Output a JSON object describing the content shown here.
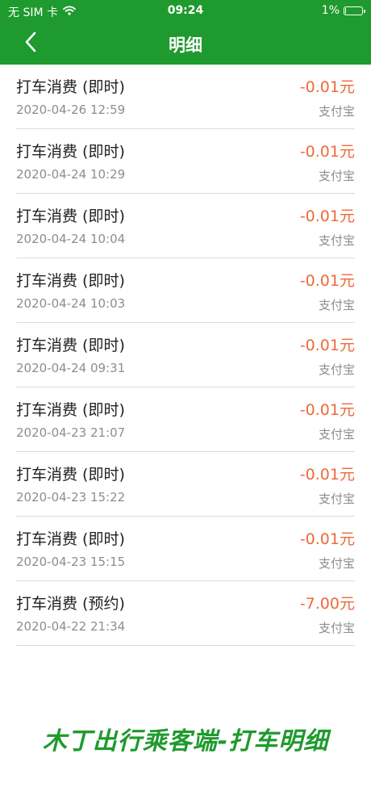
{
  "status_bar": {
    "carrier": "无 SIM 卡",
    "time": "09:24",
    "battery": "1%",
    "battery_level": 0.01
  },
  "header": {
    "title": "明细",
    "back_icon": "chevron-left-icon"
  },
  "colors": {
    "brand": "#1f9a2e",
    "amount": "#ee6a3b",
    "secondary_text": "#8d8d8d",
    "divider": "#dcdcdc"
  },
  "transactions": [
    {
      "desc": "打车消费 (即时)",
      "date": "2020-04-26 12:59",
      "amount": "-0.01元",
      "method": "支付宝"
    },
    {
      "desc": "打车消费 (即时)",
      "date": "2020-04-24 10:29",
      "amount": "-0.01元",
      "method": "支付宝"
    },
    {
      "desc": "打车消费 (即时)",
      "date": "2020-04-24 10:04",
      "amount": "-0.01元",
      "method": "支付宝"
    },
    {
      "desc": "打车消费 (即时)",
      "date": "2020-04-24 10:03",
      "amount": "-0.01元",
      "method": "支付宝"
    },
    {
      "desc": "打车消费 (即时)",
      "date": "2020-04-24 09:31",
      "amount": "-0.01元",
      "method": "支付宝"
    },
    {
      "desc": "打车消费 (即时)",
      "date": "2020-04-23 21:07",
      "amount": "-0.01元",
      "method": "支付宝"
    },
    {
      "desc": "打车消费 (即时)",
      "date": "2020-04-23 15:22",
      "amount": "-0.01元",
      "method": "支付宝"
    },
    {
      "desc": "打车消费 (即时)",
      "date": "2020-04-23 15:15",
      "amount": "-0.01元",
      "method": "支付宝"
    },
    {
      "desc": "打车消费 (预约)",
      "date": "2020-04-22 21:34",
      "amount": "-7.00元",
      "method": "支付宝"
    }
  ],
  "caption": "木丁出行乘客端-打车明细"
}
